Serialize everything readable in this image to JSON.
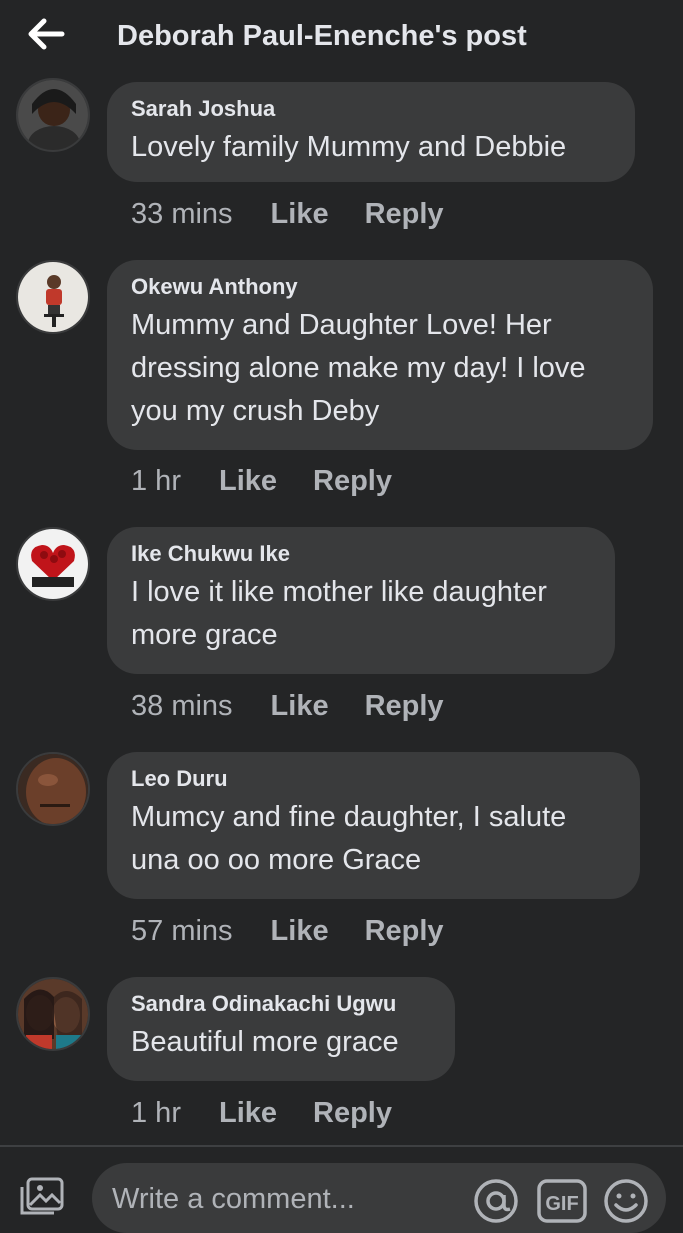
{
  "header": {
    "title": "Deborah Paul-Enenche's post"
  },
  "comments": [
    {
      "author": "Sarah Joshua",
      "text": "Lovely family Mummy and Debbie",
      "time": "33 mins",
      "like": "Like",
      "reply": "Reply"
    },
    {
      "author": "Okewu Anthony",
      "text": "Mummy and Daughter Love! Her dressing alone make my day! I love you my crush Deby",
      "time": "1 hr",
      "like": "Like",
      "reply": "Reply"
    },
    {
      "author": "Ike Chukwu Ike",
      "text": "I love it like mother like daughter more grace",
      "time": "38 mins",
      "like": "Like",
      "reply": "Reply"
    },
    {
      "author": "Leo Duru",
      "text": "Mumcy and fine daughter, I salute una oo oo more Grace",
      "time": "57 mins",
      "like": "Like",
      "reply": "Reply"
    },
    {
      "author": "Sandra Odinakachi Ugwu",
      "text": "Beautiful more grace",
      "time": "1 hr",
      "like": "Like",
      "reply": "Reply"
    }
  ],
  "composer": {
    "placeholder": "Write a comment..."
  },
  "icons": {
    "back": "arrow-left-icon",
    "photo": "photo-icon",
    "mention": "at-icon",
    "gif": "gif-icon",
    "emoji": "emoji-icon"
  },
  "colors": {
    "background": "#242526",
    "bubble": "#3a3b3c",
    "primary_text": "#e4e6eb",
    "secondary_text": "#b0b3b8"
  }
}
